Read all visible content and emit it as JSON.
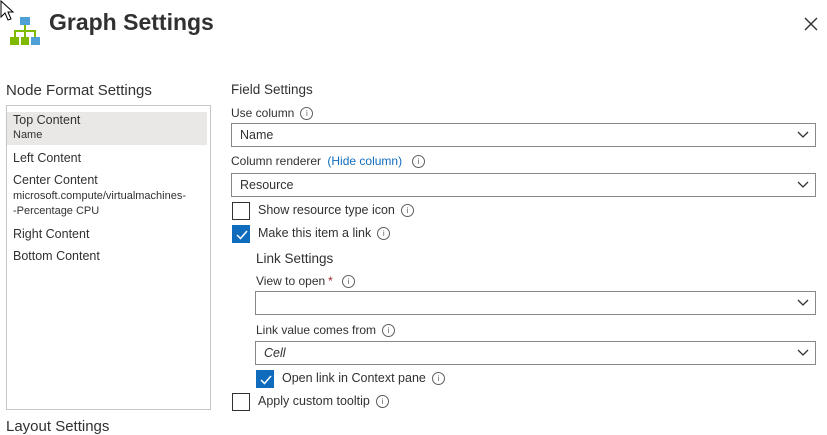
{
  "header": {
    "title": "Graph Settings"
  },
  "node_format": {
    "heading": "Node Format Settings",
    "items": [
      {
        "label": "Top Content",
        "sub": "Name",
        "selected": true
      },
      {
        "label": "Left Content",
        "sub": ""
      },
      {
        "label": "Center Content",
        "sub1": "microsoft.compute/virtualmachines-",
        "sub2": "-Percentage CPU"
      },
      {
        "label": "Right Content",
        "sub": ""
      },
      {
        "label": "Bottom Content",
        "sub": ""
      }
    ]
  },
  "layout": {
    "heading": "Layout Settings"
  },
  "field_settings": {
    "heading": "Field Settings",
    "use_column_label": "Use column",
    "use_column_value": "Name",
    "column_renderer_label": "Column renderer",
    "hide_column_link": "(Hide column)",
    "column_renderer_value": "Resource",
    "show_resource_icon_label": "Show resource type icon",
    "show_resource_icon_checked": false,
    "make_link_label": "Make this item a link",
    "make_link_checked": true,
    "link_settings": {
      "heading": "Link Settings",
      "view_to_open_label": "View to open",
      "view_to_open_required": "*",
      "view_to_open_value": "",
      "link_value_label": "Link value comes from",
      "link_value_value": "Cell",
      "open_context_label": "Open link in Context pane",
      "open_context_checked": true
    },
    "custom_tooltip_label": "Apply custom tooltip",
    "custom_tooltip_checked": false
  },
  "colors": {
    "accent": "#0f6cbd",
    "text": "#323130",
    "border": "#8a8886",
    "selected_bg": "#e9e8e7"
  }
}
